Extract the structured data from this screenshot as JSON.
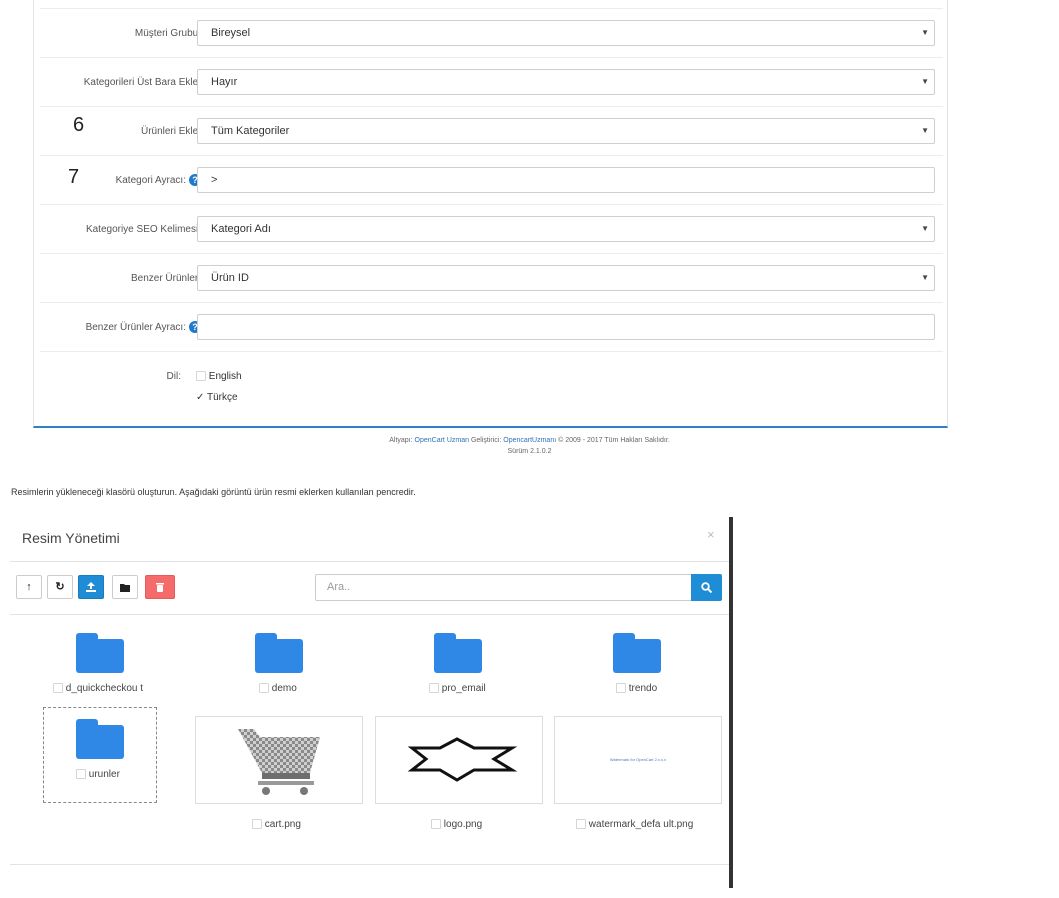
{
  "settings": {
    "customer_group": {
      "label": "Müşteri Grubu:",
      "value": "Bireysel"
    },
    "add_categories_topbar": {
      "label": "Kategorileri Üst Bara Ekle:",
      "value": "Hayır"
    },
    "add_products": {
      "label": "Ürünleri Ekle:",
      "value": "Tüm Kategoriler",
      "marker": "6"
    },
    "category_separator": {
      "label": "Kategori Ayracı:",
      "value": ">",
      "marker": "7"
    },
    "category_seo": {
      "label": "Kategoriye SEO Kelimesi:",
      "value": "Kategori Adı"
    },
    "similar_products": {
      "label": "Benzer Ürünler:",
      "value": "Ürün ID"
    },
    "similar_products_separator": {
      "label": "Benzer Ürünler Ayracı:",
      "value": ""
    },
    "language": {
      "label": "Dil:",
      "options": [
        {
          "label": "English",
          "checked": false
        },
        {
          "label": "Türkçe",
          "checked": true
        }
      ]
    }
  },
  "footer": {
    "prefix": "Altyapı:",
    "platform_link": "OpenCart Uzman",
    "dev_label": "Geliştirici:",
    "dev_link": "OpencartUzmanı",
    "copyright": "© 2009 - 2017 Tüm Hakları Saklıdır.",
    "version": "Sürüm 2.1.0.2"
  },
  "intro_text": "Resimlerin yükleneceği klasörü oluşturun. Aşağıdaki görüntü ürün resmi eklerken kullanılan pencredir.",
  "modal": {
    "title": "Resim Yönetimi",
    "close": "×",
    "search_placeholder": "Ara..",
    "toolbar": {
      "parent_icon": "level-up-icon",
      "refresh_icon": "refresh-icon",
      "upload_icon": "upload-icon",
      "folder_icon": "folder-icon",
      "delete_icon": "trash-icon"
    },
    "folders": [
      "d_quickcheckou t",
      "demo",
      "pro_email",
      "trendo",
      "urunler"
    ],
    "images": [
      {
        "name": "cart.png"
      },
      {
        "name": "logo.png"
      },
      {
        "name": "watermark_defa ult.png",
        "preview_text": "Watermark for OpenCart 2.x.x.x"
      }
    ]
  },
  "colors": {
    "accent": "#1f8dd6",
    "danger": "#f56b6b",
    "folder": "#2f87e6",
    "help": "#1f7acb"
  }
}
